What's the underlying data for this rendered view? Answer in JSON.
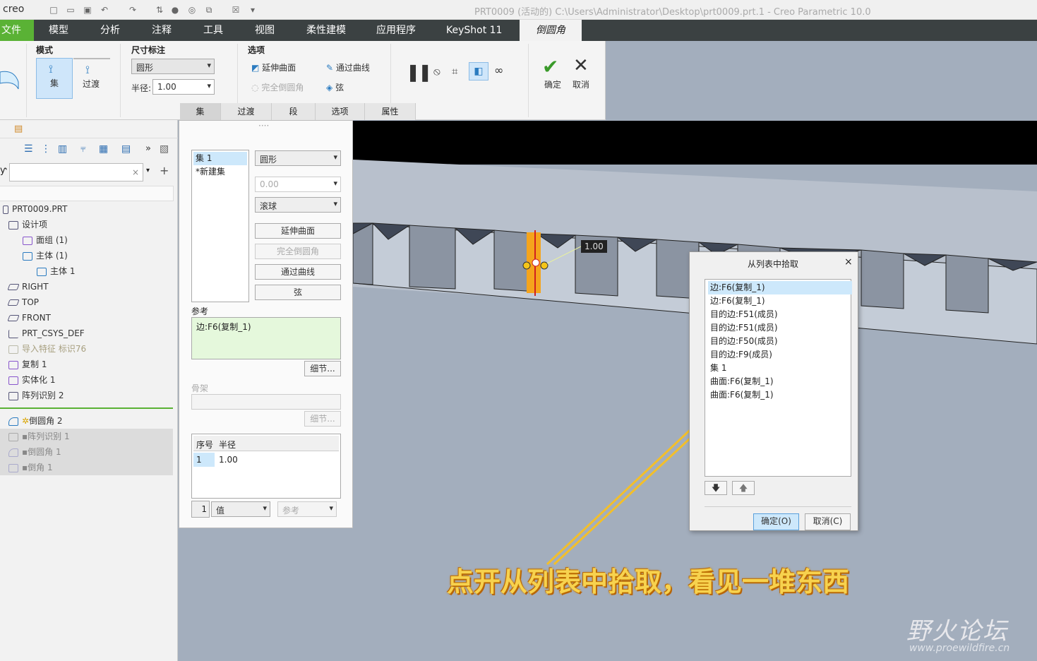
{
  "titlebar": {
    "logo": "creo",
    "title": "PRT0009 (活动的) C:\\Users\\Administrator\\Desktop\\prt0009.prt.1 - Creo Parametric 10.0"
  },
  "menu": [
    "文件",
    "模型",
    "分析",
    "注释",
    "工具",
    "视图",
    "柔性建模",
    "应用程序",
    "KeyShot 11",
    "倒圆角"
  ],
  "ribbon": {
    "mode_label": "模式",
    "mode_set": "集",
    "mode_transition": "过渡",
    "dim_label": "尺寸标注",
    "dim_shape": "圆形",
    "radius_label": "半径:",
    "radius_value": "1.00",
    "options_label": "选项",
    "opt_extend": "延伸曲面",
    "opt_full_round": "完全倒圆角",
    "opt_through_curve": "通过曲线",
    "opt_chord": "弦",
    "ok": "确定",
    "cancel": "取消",
    "tabs": [
      "集",
      "过渡",
      "段",
      "选项",
      "属性"
    ]
  },
  "tree": {
    "root": "PRT0009.PRT",
    "items": [
      {
        "label": "设计项",
        "indent": 0
      },
      {
        "label": "面组 (1)",
        "indent": 1
      },
      {
        "label": "主体 (1)",
        "indent": 1
      },
      {
        "label": "主体 1",
        "indent": 2
      },
      {
        "label": "RIGHT",
        "indent": 0
      },
      {
        "label": "TOP",
        "indent": 0
      },
      {
        "label": "FRONT",
        "indent": 0
      },
      {
        "label": "PRT_CSYS_DEF",
        "indent": 0
      },
      {
        "label": "导入特征 标识76",
        "indent": 0
      },
      {
        "label": "复制 1",
        "indent": 0
      },
      {
        "label": "实体化 1",
        "indent": 0
      },
      {
        "label": "阵列识别 2",
        "indent": 0
      }
    ],
    "after": [
      {
        "label": "倒圆角 2"
      },
      {
        "label": "阵列识别 1"
      },
      {
        "label": "倒圆角 1"
      },
      {
        "label": "倒角 1"
      }
    ]
  },
  "setpanel": {
    "sets": [
      "集 1",
      "*新建集"
    ],
    "shape": "圆形",
    "value": "0.00",
    "method": "滚球",
    "btn_extend": "延伸曲面",
    "btn_full_round": "完全倒圆角",
    "btn_through_curve": "通过曲线",
    "btn_chord": "弦",
    "ref_label": "参考",
    "ref_value": "边:F6(复制_1)",
    "detail": "细节...",
    "spine_label": "骨架",
    "detail2": "细节...",
    "table_headers": [
      "序号",
      "半径"
    ],
    "table_row": [
      "1",
      "1.00"
    ],
    "bottom_num": "1",
    "bottom_value": "值",
    "bottom_ref": "参考"
  },
  "viewport": {
    "dim_label": "1.00"
  },
  "dialog": {
    "title": "从列表中拾取",
    "items": [
      "边:F6(复制_1)",
      "边:F6(复制_1)",
      "目的边:F51(成员)",
      "目的边:F51(成员)",
      "目的边:F50(成员)",
      "目的边:F9(成员)",
      "集 1",
      "曲面:F6(复制_1)",
      "曲面:F6(复制_1)"
    ],
    "ok": "确定(O)",
    "cancel": "取消(C)"
  },
  "caption": "点开从列表中拾取，看见一堆东西",
  "watermark": {
    "name": "野火论坛",
    "url": "www.proewildfire.cn"
  }
}
